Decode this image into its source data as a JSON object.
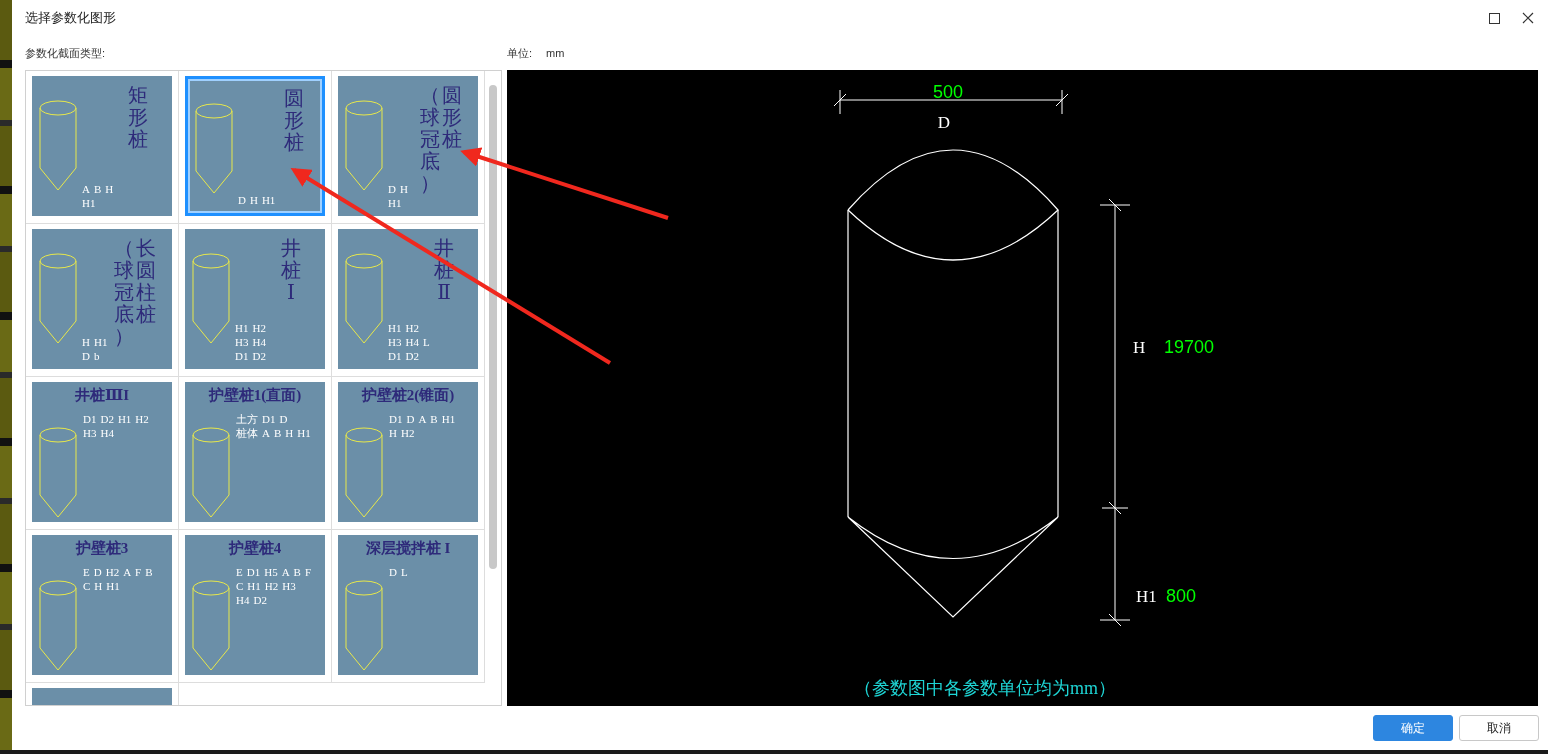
{
  "window": {
    "title": "选择参数化图形"
  },
  "section_label": "参数化截面类型:",
  "unit": {
    "label": "单位:",
    "value": "mm"
  },
  "tiles": [
    {
      "kind": "vertical",
      "title": "矩形桩",
      "labels": [
        "A",
        "B",
        "H",
        "H1"
      ],
      "selected": false
    },
    {
      "kind": "vertical",
      "title": "圆形桩",
      "labels": [
        "D",
        "H",
        "H1"
      ],
      "selected": true
    },
    {
      "kind": "vertical",
      "title": "圆形桩",
      "note": "（球冠底）",
      "labels": [
        "D",
        "H",
        "H1"
      ],
      "selected": false
    },
    {
      "kind": "vertical",
      "title": "长圆柱桩",
      "note": "（球冠底）",
      "labels": [
        "H",
        "H1",
        "D",
        "b"
      ],
      "selected": false
    },
    {
      "kind": "vertical",
      "title": "井桩Ⅰ",
      "labels": [
        "H1",
        "H2",
        "H3",
        "H4",
        "D1",
        "D2"
      ],
      "selected": false
    },
    {
      "kind": "vertical",
      "title": "井桩Ⅱ",
      "labels": [
        "H1",
        "H2",
        "H3",
        "H4",
        "L",
        "D1",
        "D2"
      ],
      "selected": false
    },
    {
      "kind": "horizontal",
      "title": "井桩ⅢI",
      "labels": [
        "D1",
        "D2",
        "H1",
        "H2",
        "H3",
        "H4"
      ],
      "selected": false
    },
    {
      "kind": "horizontal",
      "title": "护壁桩1(直面)",
      "labels": [
        "土方",
        "D1",
        "D",
        "桩体",
        "A",
        "B",
        "H",
        "H1"
      ],
      "selected": false
    },
    {
      "kind": "horizontal",
      "title": "护壁桩2(锥面)",
      "labels": [
        "D1",
        "D",
        "A",
        "B",
        "H1",
        "H",
        "H2"
      ],
      "selected": false
    },
    {
      "kind": "horizontal",
      "title": "护壁桩3",
      "labels": [
        "E",
        "D",
        "H2",
        "A",
        "F",
        "B",
        "C",
        "H",
        "H1"
      ],
      "selected": false
    },
    {
      "kind": "horizontal",
      "title": "护壁桩4",
      "labels": [
        "E",
        "D1",
        "H5",
        "A",
        "B",
        "F",
        "C",
        "H1",
        "H2",
        "H3",
        "H4",
        "D2"
      ],
      "selected": false
    },
    {
      "kind": "horizontal",
      "title": "深层搅拌桩 I",
      "labels": [
        "D",
        "L"
      ],
      "selected": false
    },
    {
      "kind": "partial",
      "selected": false
    }
  ],
  "preview": {
    "width_value": "500",
    "width_label": "D",
    "height_label": "H",
    "height_value": "19700",
    "tip_label": "H1",
    "tip_value": "800",
    "caption": "（参数图中各参数单位均为mm）"
  },
  "buttons": [
    {
      "label": "确定",
      "kind": "primary"
    },
    {
      "label": "取消",
      "kind": "secondary"
    }
  ]
}
